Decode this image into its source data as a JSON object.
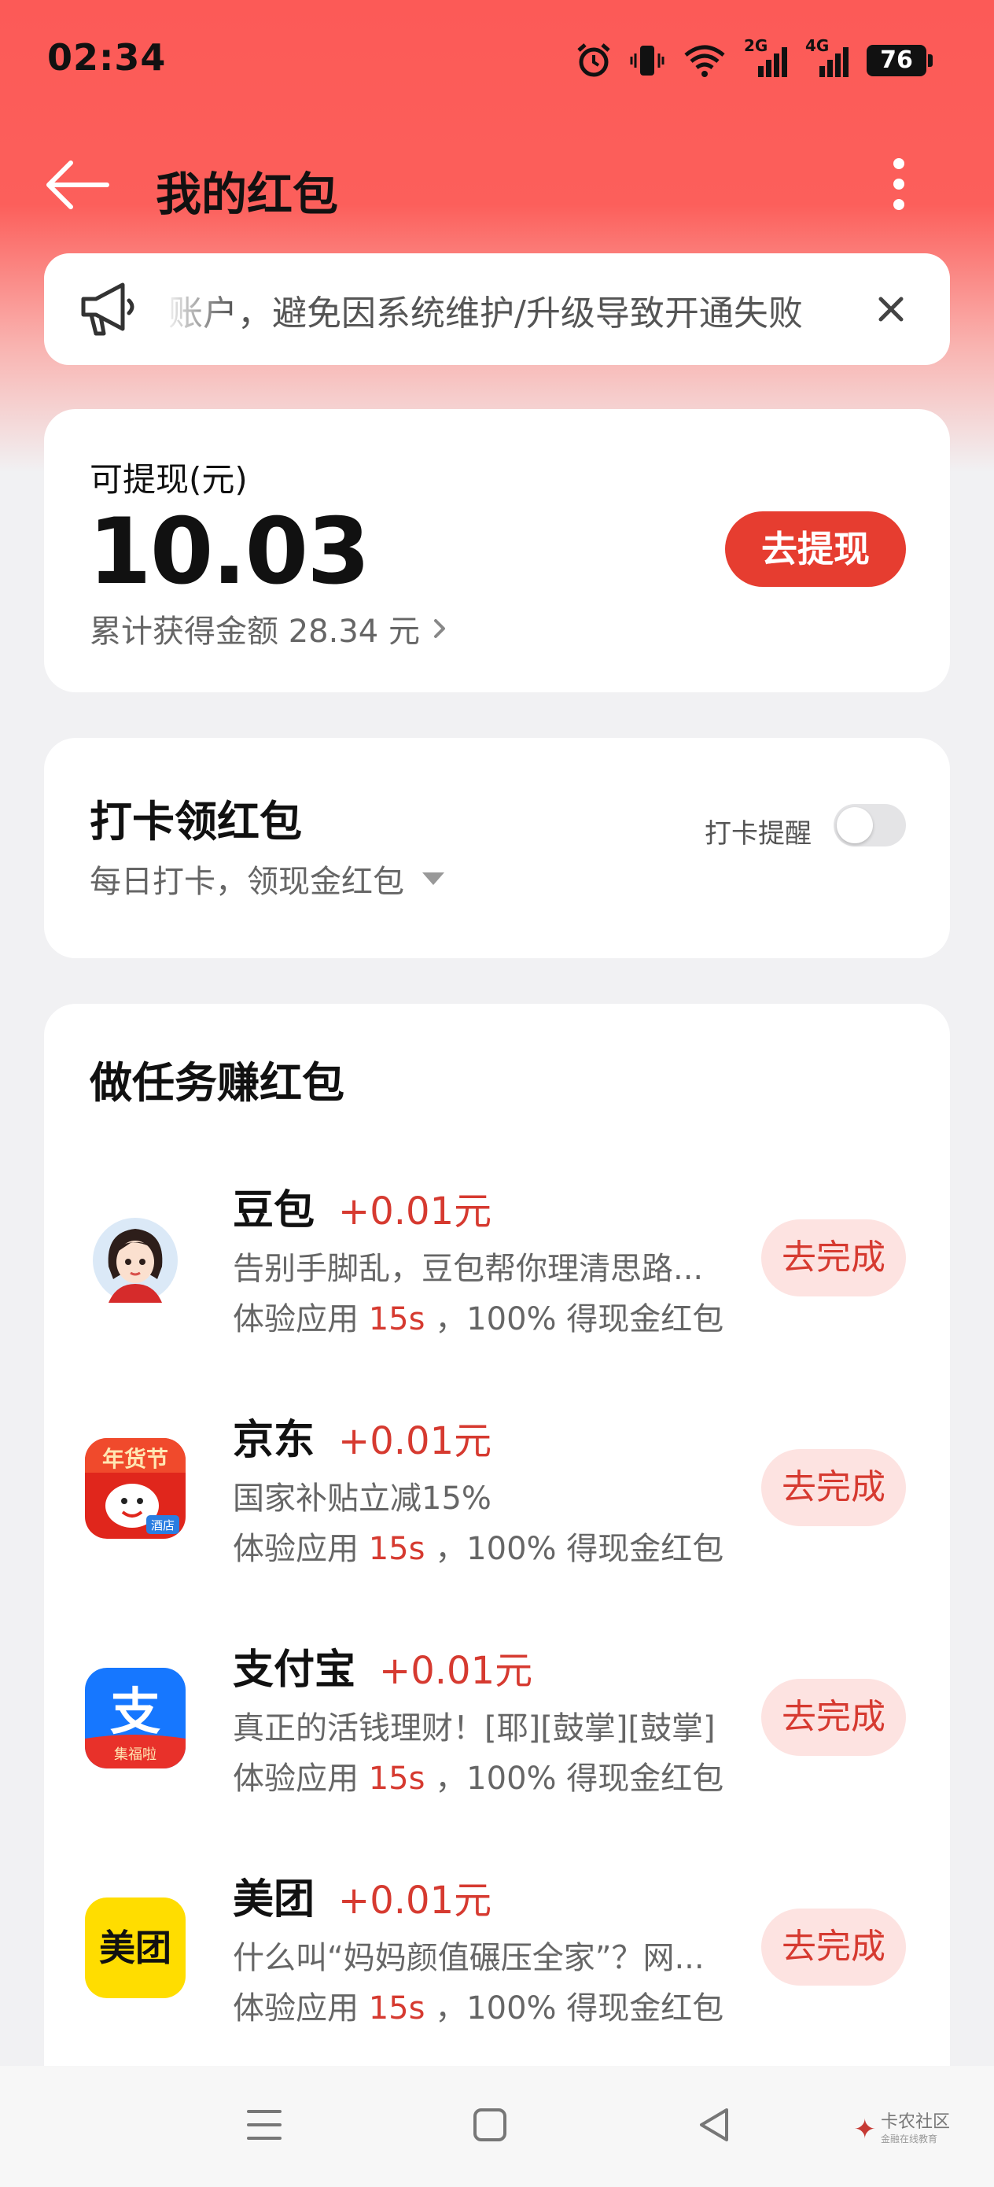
{
  "status_bar": {
    "time": "02:34",
    "network_2g": "2G",
    "network_4g": "4G",
    "battery": "76"
  },
  "header": {
    "title": "我的红包"
  },
  "notice": {
    "text": "账户，避免因系统维护/升级导致开通失败"
  },
  "balance": {
    "label": "可提现(元)",
    "amount": "10.03",
    "withdraw_label": "去提现",
    "total_label": "累计获得金额 28.34 元"
  },
  "checkin": {
    "title": "打卡领红包",
    "subtitle": "每日打卡，领现金红包",
    "remind_label": "打卡提醒",
    "remind_on": false
  },
  "tasks": {
    "title": "做任务赚红包",
    "items": [
      {
        "name": "豆包",
        "reward": "+0.01元",
        "desc": "告别手脚乱，豆包帮你理清思路...",
        "meta_prefix": "体验应用",
        "meta_time": "15s",
        "meta_suffix": "，100% 得现金红包",
        "button": "去完成",
        "icon": "doubao-app-icon"
      },
      {
        "name": "京东",
        "reward": "+0.01元",
        "desc": "国家补贴立减15%",
        "meta_prefix": "体验应用",
        "meta_time": "15s",
        "meta_suffix": "，100% 得现金红包",
        "button": "去完成",
        "icon": "jd-app-icon",
        "icon_text_top": "年货节",
        "icon_text_badge": "酒店"
      },
      {
        "name": "支付宝",
        "reward": "+0.01元",
        "desc": "真正的活钱理财！[耶][鼓掌][鼓掌]",
        "meta_prefix": "体验应用",
        "meta_time": "15s",
        "meta_suffix": "，100% 得现金红包",
        "button": "去完成",
        "icon": "alipay-app-icon",
        "icon_glyph": "支",
        "icon_text_band": "集福啦"
      },
      {
        "name": "美团",
        "reward": "+0.01元",
        "desc": "什么叫“妈妈颜值碾压全家”？网...",
        "meta_prefix": "体验应用",
        "meta_time": "15s",
        "meta_suffix": "，100% 得现金红包",
        "button": "去完成",
        "icon": "meituan-app-icon",
        "icon_text": "美团"
      }
    ]
  },
  "watermark": {
    "text": "卡农社区",
    "sub": "金融在线教育"
  },
  "colors": {
    "brand_red": "#e63d30",
    "reward_red": "#d63a30",
    "button_pink": "#fde3e1",
    "header_red": "#fc5a57"
  }
}
